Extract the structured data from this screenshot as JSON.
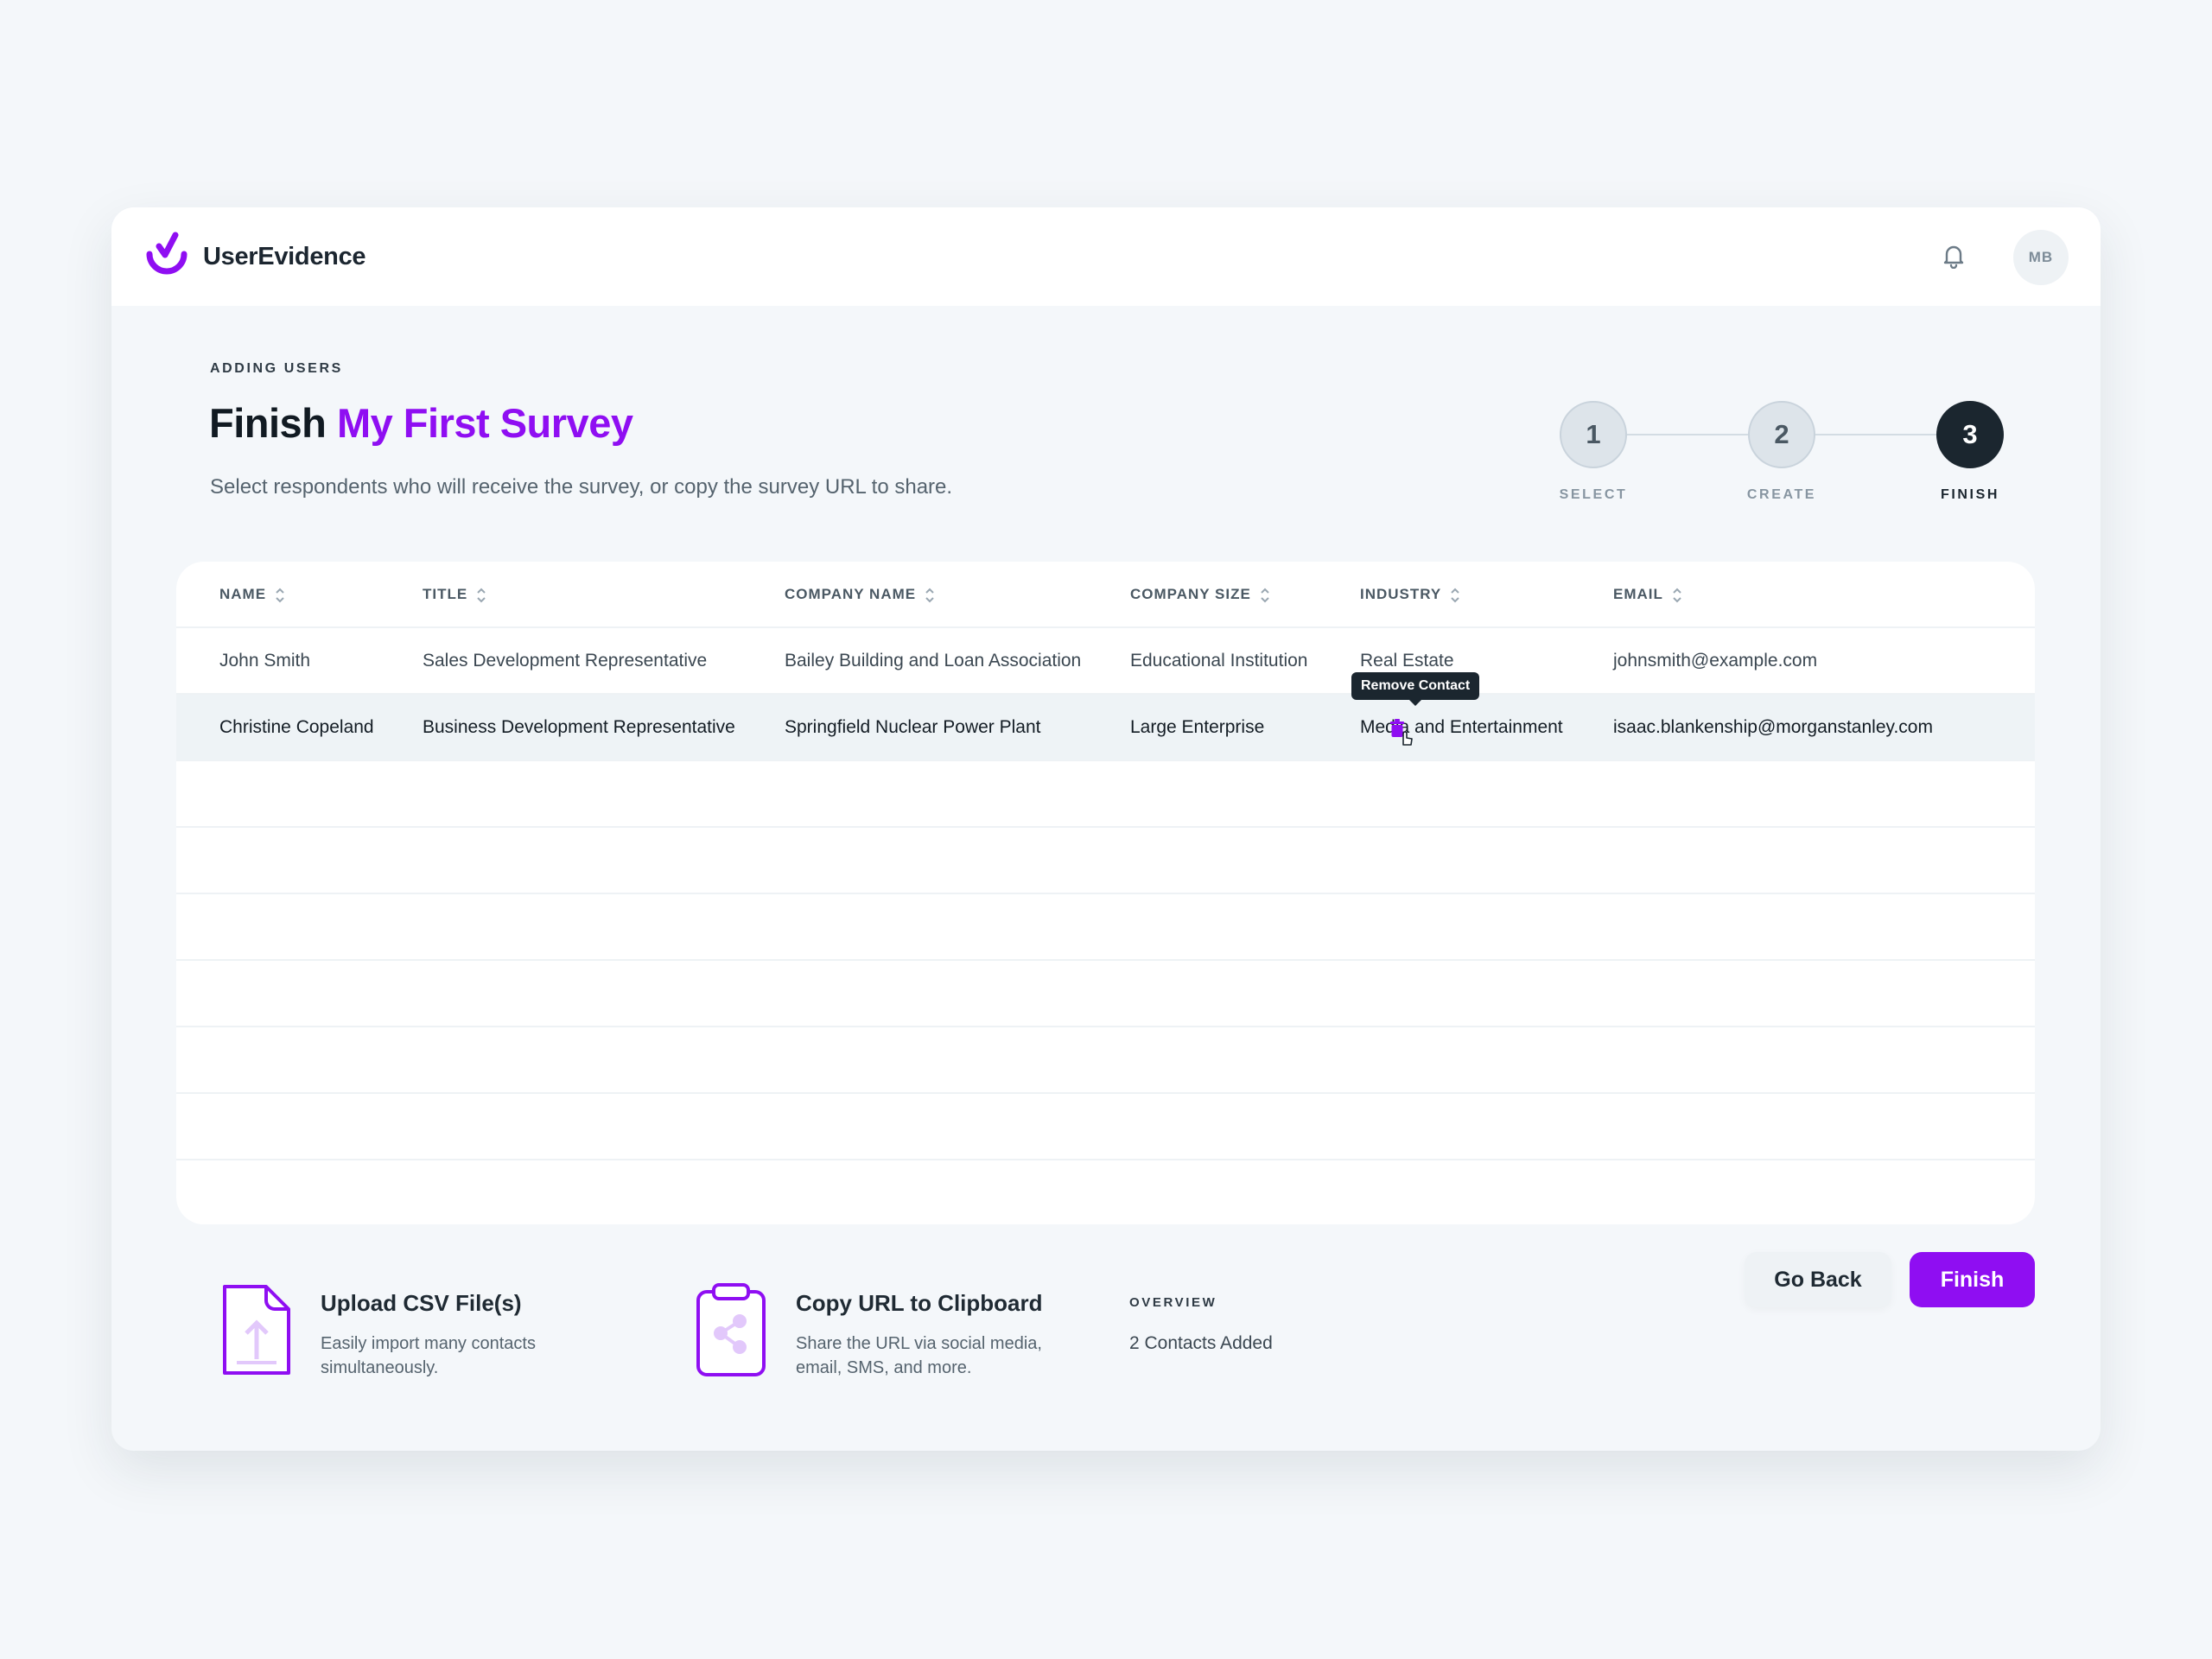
{
  "app": {
    "brand": "UserEvidence",
    "avatar_initials": "MB",
    "accent_color": "#8f0ef2"
  },
  "header": {
    "eyebrow": "ADDING USERS",
    "title_prefix": "Finish",
    "title_highlight": "My First Survey",
    "subtitle": "Select respondents who will receive the survey, or copy the survey URL to share."
  },
  "steps": [
    {
      "number": "1",
      "label": "SELECT",
      "state": "done"
    },
    {
      "number": "2",
      "label": "CREATE",
      "state": "done"
    },
    {
      "number": "3",
      "label": "FINISH",
      "state": "active"
    }
  ],
  "table": {
    "columns": [
      "NAME",
      "TITLE",
      "COMPANY NAME",
      "COMPANY SIZE",
      "INDUSTRY",
      "EMAIL"
    ],
    "rows": [
      [
        "John Smith",
        "Sales Development Representative",
        "Bailey Building and Loan Association",
        "Educational Institution",
        "Real Estate",
        "johnsmith@example.com"
      ],
      [
        "Christine Copeland",
        "Business Development Representative",
        "Springfield Nuclear Power Plant",
        "Large Enterprise",
        "Media and Entertainment",
        "isaac.blankenship@morganstanley.com"
      ]
    ],
    "tooltip": "Remove Contact"
  },
  "actions": {
    "upload": {
      "title": "Upload CSV File(s)",
      "description": "Easily import many contacts simultaneously."
    },
    "copy": {
      "title": "Copy URL to Clipboard",
      "description": "Share the URL via social media, email, SMS, and more."
    }
  },
  "overview": {
    "label": "OVERVIEW",
    "value": "2 Contacts Added"
  },
  "buttons": {
    "back": "Go Back",
    "finish": "Finish"
  }
}
